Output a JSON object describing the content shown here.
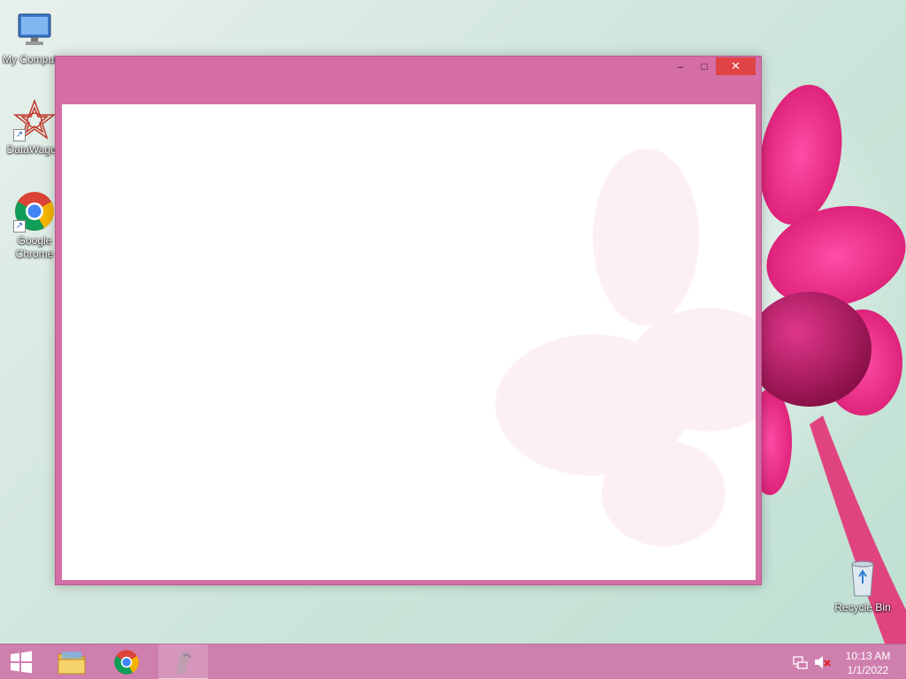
{
  "desktop": {
    "icons": [
      {
        "label": "My Computer",
        "icon": "computer-icon"
      },
      {
        "label": "DataWagon",
        "icon": "datawagon-icon"
      },
      {
        "label": "Google Chrome",
        "icon": "chrome-icon"
      },
      {
        "label": "Recycle Bin",
        "icon": "recycle-bin-icon"
      }
    ]
  },
  "window": {
    "title": "",
    "controls": {
      "minimize": "–",
      "maximize": "□",
      "close": "✕"
    },
    "accent_color": "#d56ea6"
  },
  "taskbar": {
    "color": "#cf7fae",
    "pinned": [
      {
        "name": "File Explorer",
        "icon": "folder-icon"
      },
      {
        "name": "Google Chrome",
        "icon": "chrome-icon"
      },
      {
        "name": "Running app",
        "icon": "app-icon"
      }
    ],
    "tray": {
      "network_icon": "network-icon",
      "volume_icon": "volume-muted-icon"
    },
    "clock": {
      "time": "10:13 AM",
      "date": "1/1/2022"
    }
  }
}
